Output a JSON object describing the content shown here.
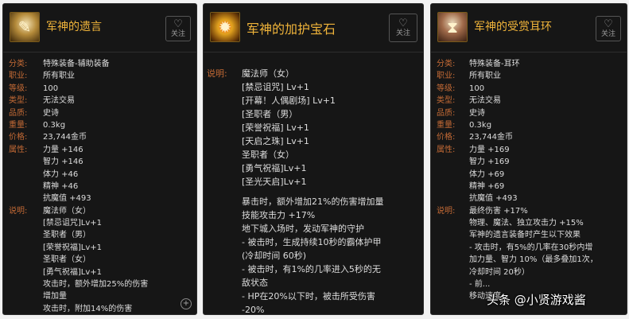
{
  "panels": [
    {
      "title": "军神的遗言",
      "follow_label": "关注",
      "rows": [
        {
          "k": "分类:",
          "v": "特殊装备-辅助装备"
        },
        {
          "k": "职业:",
          "v": "所有职业"
        },
        {
          "k": "等级:",
          "v": "100"
        },
        {
          "k": "类型:",
          "v": "无法交易"
        },
        {
          "k": "品质:",
          "v": "史诗"
        },
        {
          "k": "重量:",
          "v": "0.3kg"
        },
        {
          "k": "价格:",
          "v": "23,744金币"
        },
        {
          "k": "属性:",
          "v": "力量 +146"
        },
        {
          "k": "",
          "v": "智力 +146"
        },
        {
          "k": "",
          "v": "体力 +46"
        },
        {
          "k": "",
          "v": "精神 +46"
        },
        {
          "k": "",
          "v": "抗魔值 +493"
        },
        {
          "k": "说明:",
          "v": "魔法师（女）"
        },
        {
          "k": "",
          "v": "[禁忌诅咒]Lv+1"
        },
        {
          "k": "",
          "v": "圣职者（男）"
        },
        {
          "k": "",
          "v": "[荣誉祝福]Lv+1"
        },
        {
          "k": "",
          "v": "圣职者（女）"
        },
        {
          "k": "",
          "v": "[勇气祝福]Lv+1"
        },
        {
          "k": "",
          "v": "攻击时，额外增加25%的伤害"
        },
        {
          "k": "",
          "v": "增加量"
        },
        {
          "k": "",
          "v": "攻击时，附加14%的伤害"
        }
      ]
    },
    {
      "title": "军神的加护宝石",
      "follow_label": "关注",
      "desc_key": "说明:",
      "lines_a": [
        "魔法师（女）",
        "[禁忌诅咒] Lv+1",
        "[开幕！人偶剧场] Lv+1",
        "[圣职者（男）",
        "[荣誉祝福] Lv+1",
        "[天启之珠] Lv+1",
        "圣职者（女）",
        "[勇气祝福]Lv+1",
        "[圣光天启]Lv+1"
      ],
      "lines_b": [
        "暴击时，额外增加21%的伤害增加量",
        "技能攻击力 +17%",
        "地下城入场时，发动军神的守护",
        "- 被击时，生成持续10秒的霸体护甲",
        "  (冷却时间 60秒)",
        "- 被击时，有1%的几率进入5秒的无",
        "敌状态",
        "- HP在20%以下时，被击所受伤害",
        "-20%"
      ]
    },
    {
      "title": "军神的受赏耳环",
      "follow_label": "关注",
      "rows": [
        {
          "k": "分类:",
          "v": "特殊装备-耳环"
        },
        {
          "k": "职业:",
          "v": "所有职业"
        },
        {
          "k": "等级:",
          "v": "100"
        },
        {
          "k": "类型:",
          "v": "无法交易"
        },
        {
          "k": "品质:",
          "v": "史诗"
        },
        {
          "k": "重量:",
          "v": "0.3kg"
        },
        {
          "k": "价格:",
          "v": "23,744金币"
        },
        {
          "k": "属性:",
          "v": "力量 +169"
        },
        {
          "k": "",
          "v": "智力 +169"
        },
        {
          "k": "",
          "v": "体力 +69"
        },
        {
          "k": "",
          "v": "精神 +69"
        },
        {
          "k": "",
          "v": "抗魔值 +493"
        },
        {
          "k": "说明:",
          "v": "最终伤害 +17%"
        },
        {
          "k": "",
          "v": "物理、魔法、独立攻击力 +15%"
        },
        {
          "k": "",
          "v": "军神的遗言装备时产生以下效果"
        },
        {
          "k": "",
          "v": "- 攻击时，有5%的几率在30秒内增"
        },
        {
          "k": "",
          "v": "加力量、智力 10%（最多叠加1次，"
        },
        {
          "k": "",
          "v": "冷却时间 20秒）"
        },
        {
          "k": "",
          "v": "- 前..."
        },
        {
          "k": "",
          "v": "移动速度..."
        }
      ]
    }
  ],
  "watermark": "头条 @小贤游戏酱"
}
